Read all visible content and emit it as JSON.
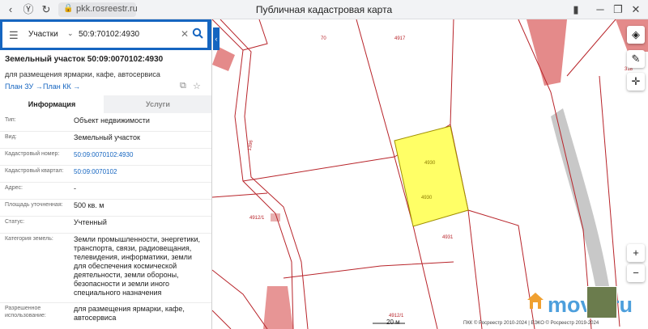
{
  "browser": {
    "url": "pkk.rosreestr.ru",
    "title": "Публичная кадастровая карта"
  },
  "search": {
    "type_label": "Участки",
    "value": "50:9:70102:4930"
  },
  "object": {
    "title": "Земельный участок 50:09:0070102:4930",
    "subtitle": "для размещения ярмарки, кафе, автосервиса",
    "plan_zu": "План ЗУ →",
    "plan_kk": "План КК →"
  },
  "tabs": {
    "info": "Информация",
    "services": "Услуги"
  },
  "rows": [
    {
      "key": "Тип:",
      "value": "Объект недвижимости"
    },
    {
      "key": "Вид:",
      "value": "Земельный участок"
    },
    {
      "key": "Кадастровый номер:",
      "value": "50:09:0070102:4930"
    },
    {
      "key": "Кадастровый квартал:",
      "value": "50:09:0070102"
    },
    {
      "key": "Адрес:",
      "value": "-"
    },
    {
      "key": "Площадь уточненная:",
      "value": "500 кв. м"
    },
    {
      "key": "Статус:",
      "value": "Учтенный"
    },
    {
      "key": "Категория земель:",
      "value": "Земли промышленности, энергетики, транспорта, связи, радиовещания, телевидения, информатики, земли для обеспечения космической деятельности, земли обороны, безопасности и земли иного специального назначения"
    },
    {
      "key": "Разрешенное использование:",
      "value": "для размещения ярмарки, кафе, автосервиса"
    }
  ],
  "map": {
    "labels": {
      "l70": "70",
      "l4917": "4917",
      "l318": "318",
      "l1396": "1396",
      "l4930a": "4930",
      "l4930b": "4930",
      "l4912_1a": "4912/1",
      "l4931": "4931",
      "l4912_1b": "4912/1"
    },
    "scale": "20 м",
    "copyright": "ПКК © Росреестр 2010-2024 | ЕЭКО © Росреестр 2019-2024",
    "brand": "move.ru",
    "colors": {
      "parcel_fill": "#ffff66",
      "parcel_stroke": "#a09000",
      "boundary": "#b8242a",
      "building": "#e48a8a",
      "accent": "#1565c0"
    }
  },
  "controls": {
    "layers_icon": "layers-icon",
    "ruler_icon": "ruler-icon",
    "locate_icon": "locate-icon",
    "zoom_in": "+",
    "zoom_out": "−"
  }
}
